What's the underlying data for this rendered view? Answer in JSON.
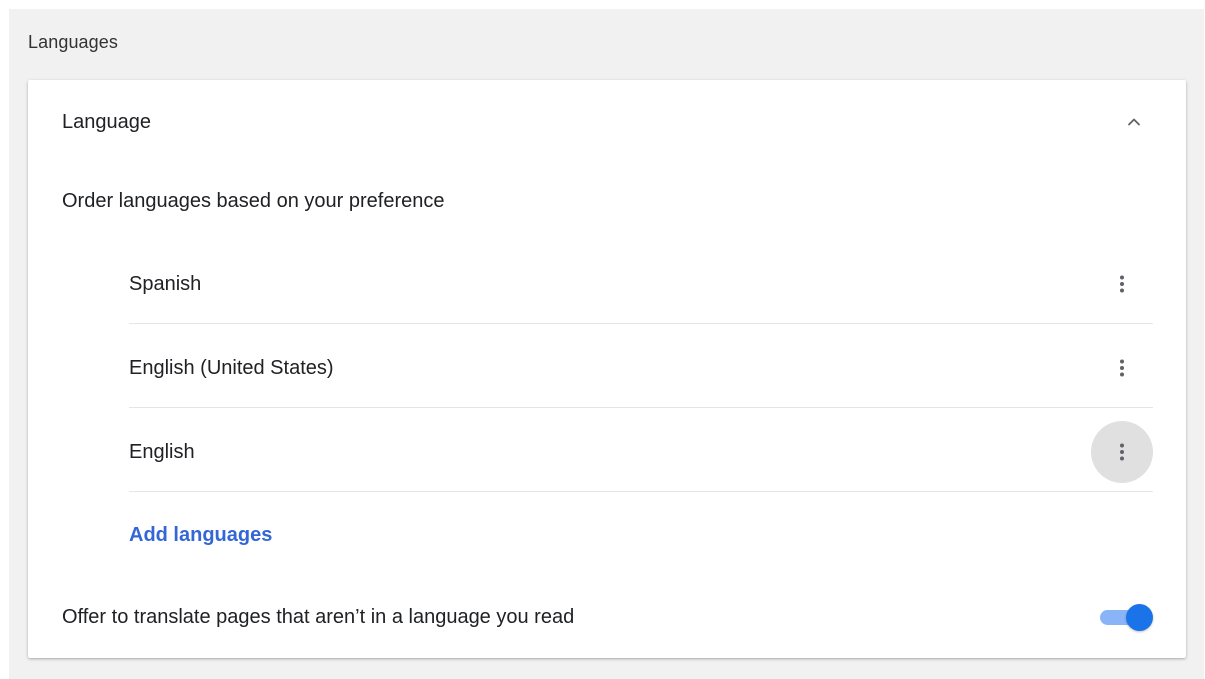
{
  "section": {
    "title": "Languages"
  },
  "card": {
    "header_label": "Language",
    "expanded": true,
    "collapse_icon": "chevron-up-icon",
    "subheading": "Order languages based on your preference",
    "languages": [
      {
        "label": "Spanish",
        "menu_icon": "more-vert-icon",
        "menu_active": false
      },
      {
        "label": "English (United States)",
        "menu_icon": "more-vert-icon",
        "menu_active": false
      },
      {
        "label": "English",
        "menu_icon": "more-vert-icon",
        "menu_active": true
      }
    ],
    "add_languages_label": "Add languages",
    "translate_offer": {
      "label": "Offer to translate pages that aren’t in a language you read",
      "enabled": true
    }
  },
  "colors": {
    "page_background": "#f1f1f1",
    "card_background": "#ffffff",
    "link": "#3367d6",
    "toggle_knob_on": "#1a73e8",
    "toggle_track_on": "#8ab4f8",
    "divider": "#e5e5e5",
    "menu_active_bg": "#e0e0e0"
  }
}
